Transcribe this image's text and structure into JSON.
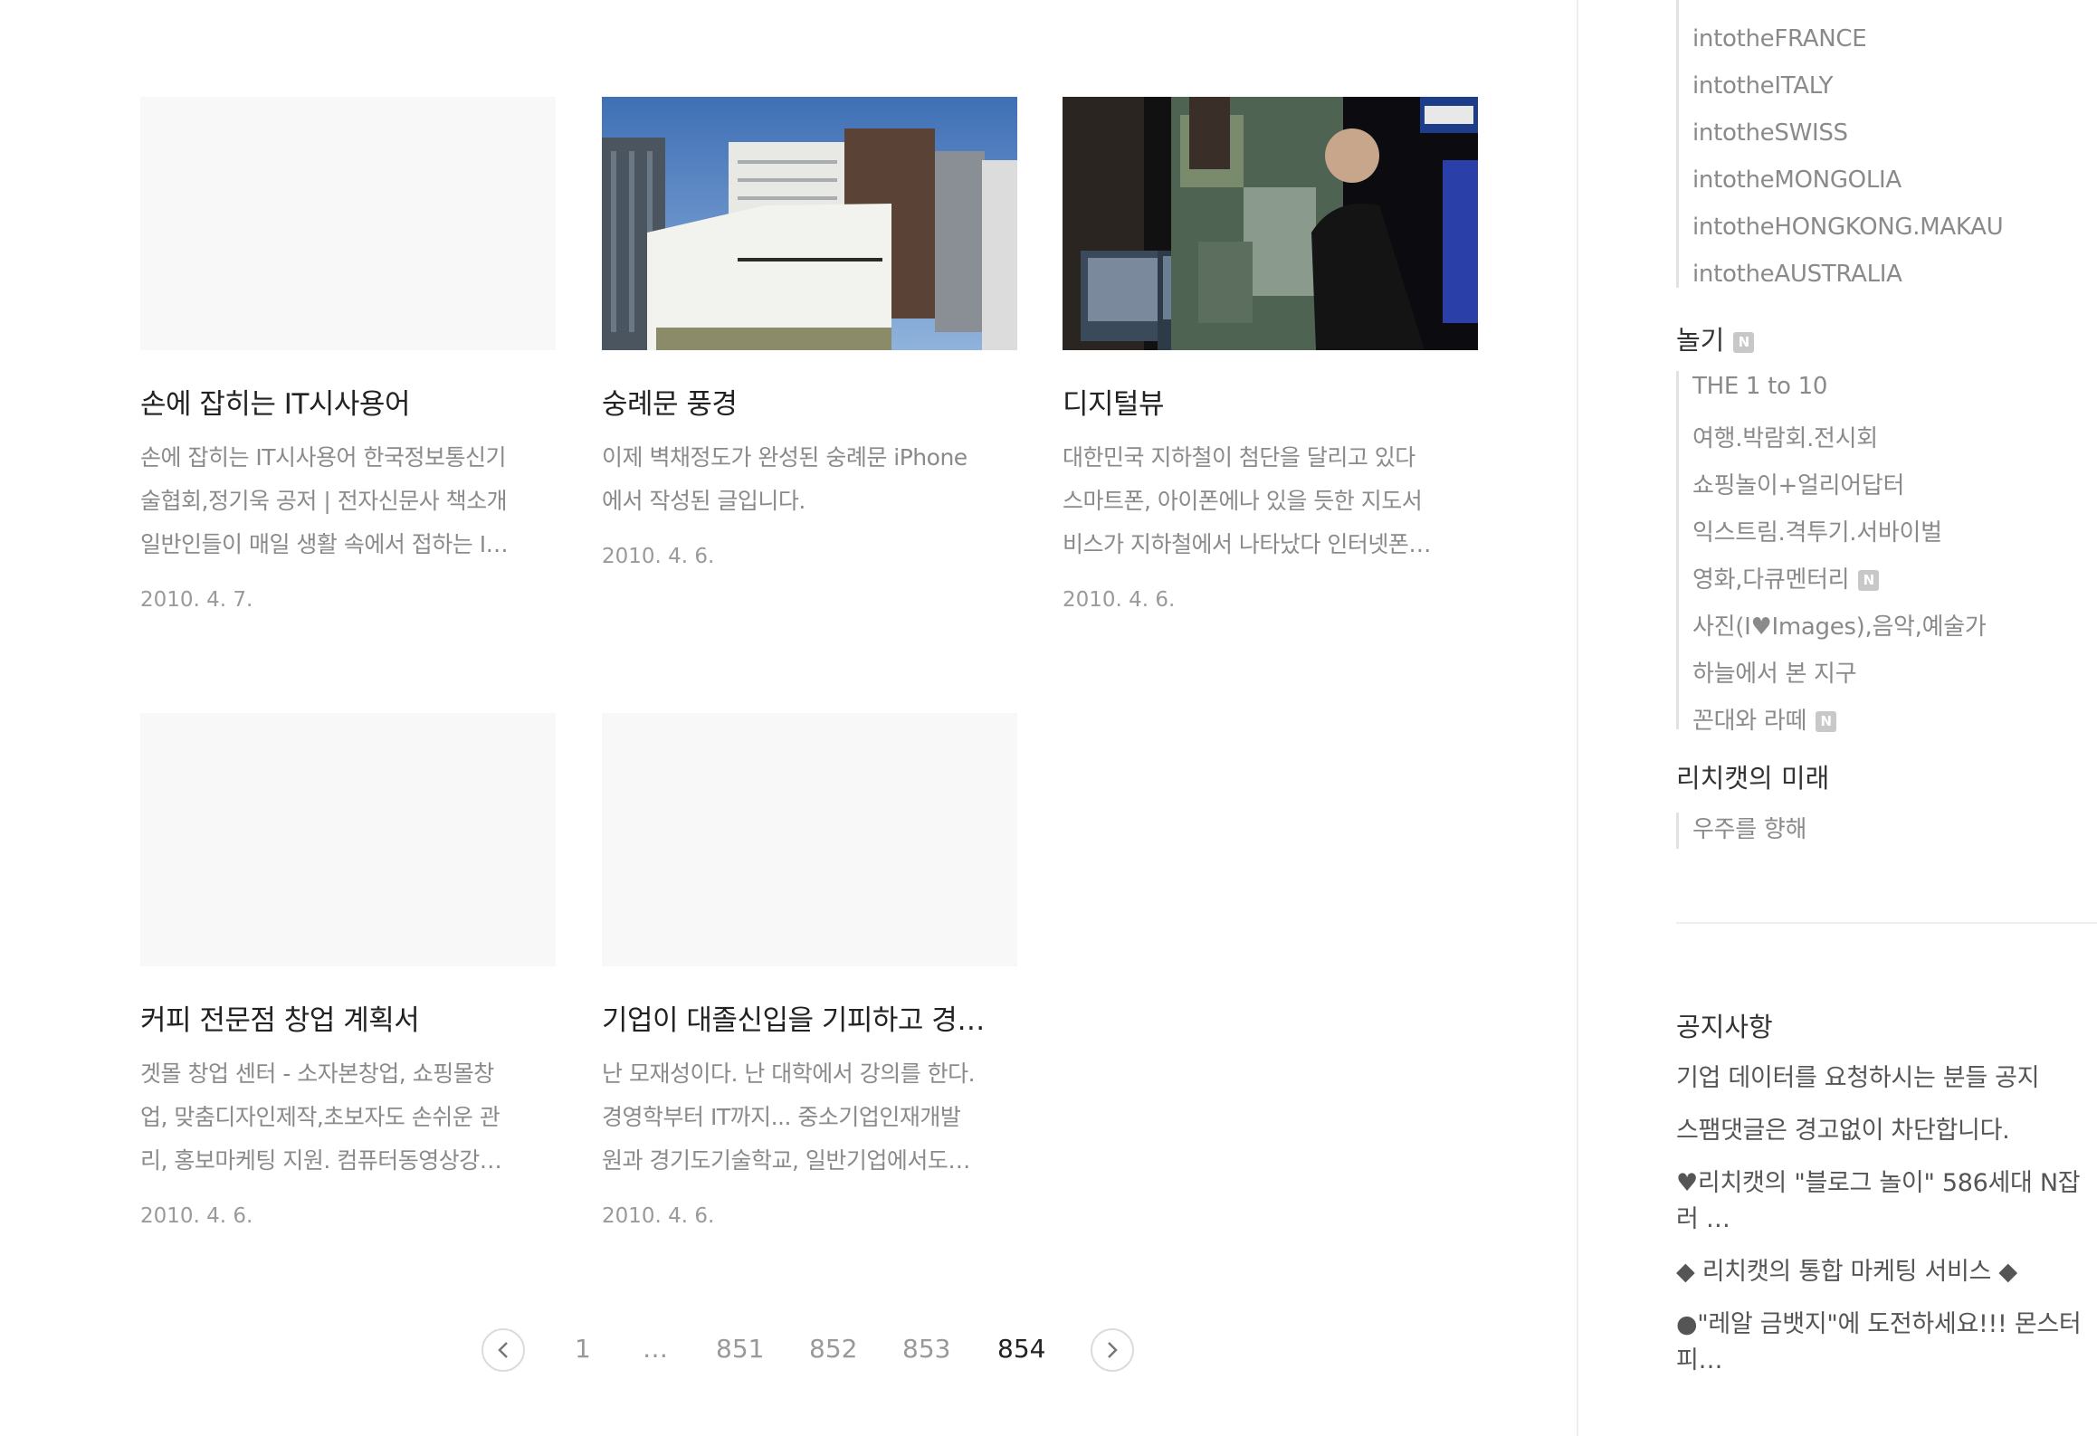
{
  "posts": [
    {
      "title": "손에 잡히는 IT시사용어",
      "excerpt": [
        "손에 잡히는 IT시사용어 한국정보통신기",
        "술협회,정기욱 공저 | 전자신문사 책소개",
        "일반인들이 매일 생활 속에서 접하는 I…"
      ],
      "date": "2010. 4. 7."
    },
    {
      "title": "숭례문 풍경",
      "excerpt": [
        "이제 벽채정도가 완성된 숭례문 iPhone",
        "에서 작성된 글입니다."
      ],
      "date": "2010. 4. 6."
    },
    {
      "title": "디지털뷰",
      "excerpt": [
        "대한민국 지하철이 첨단을 달리고 있다",
        "스마트폰, 아이폰에나 있을 듯한 지도서",
        "비스가 지하철에서 나타났다 인터넷폰…"
      ],
      "date": "2010. 4. 6."
    },
    {
      "title": "커피 전문점 창업 계획서",
      "excerpt": [
        "겟몰 창업 센터 - 소자본창업, 쇼핑몰창",
        "업, 맞춤디자인제작,초보자도 손쉬운 관",
        "리, 홍보마케팅 지원. 컴퓨터동영상강…"
      ],
      "date": "2010. 4. 6."
    },
    {
      "title": "기업이 대졸신입을 기피하고 경…",
      "excerpt": [
        "난 모재성이다. 난 대학에서 강의를 한다.",
        "경영학부터 IT까지... 중소기업인재개발",
        "원과 경기도기술학교, 일반기업에서도…"
      ],
      "date": "2010. 4. 6."
    }
  ],
  "pagination": {
    "prev_icon": "chevron-left-icon",
    "next_icon": "chevron-right-icon",
    "pages": [
      "1",
      "…",
      "851",
      "852",
      "853",
      "854"
    ],
    "current": "854"
  },
  "sidebar": {
    "travel_items": [
      "intotheFRANCE",
      "intotheITALY",
      "intotheSWISS",
      "intotheMONGOLIA",
      "intotheHONGKONG.MAKAU",
      "intotheAUSTRALIA"
    ],
    "play": {
      "title": "놀기",
      "badge": "N",
      "items": [
        {
          "label": "THE 1 to 10",
          "new": false
        },
        {
          "label": "여행.박람회.전시회",
          "new": false
        },
        {
          "label": "쇼핑놀이+얼리어답터",
          "new": false
        },
        {
          "label": "익스트림.격투기.서바이벌",
          "new": false
        },
        {
          "label": "영화,다큐멘터리",
          "new": true
        },
        {
          "label": "사진(I♥Images),음악,예술가",
          "new": false
        },
        {
          "label": "하늘에서 본 지구",
          "new": false
        },
        {
          "label": "꼰대와 라떼",
          "new": true
        }
      ]
    },
    "future": {
      "title": "리치캣의 미래",
      "items": [
        "우주를 향해"
      ]
    },
    "notice": {
      "title": "공지사항",
      "items": [
        "기업 데이터를 요청하시는 분들 공지",
        "스팸댓글은 경고없이 차단합니다.",
        "♥리치캣의 \"블로그 놀이\" 586세대 N잡러 …",
        "◆ 리치캣의 통합 마케팅 서비스 ◆",
        "●\"레알 금뱃지\"에 도전하세요!!! 몬스터피…"
      ]
    }
  }
}
